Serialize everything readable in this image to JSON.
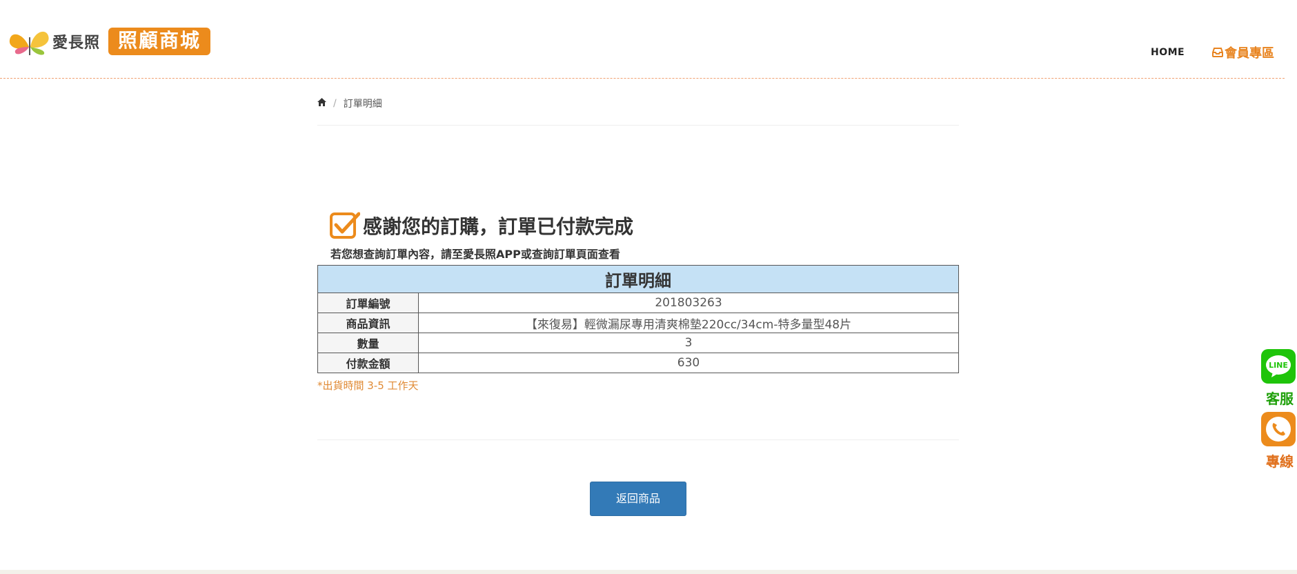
{
  "header": {
    "brand_text": "愛長照",
    "brand_pill": "照顧商城",
    "nav": {
      "home": "HOME",
      "member": "會員專區"
    }
  },
  "breadcrumb": {
    "home_icon": "home-icon",
    "current": "訂單明細"
  },
  "success": {
    "icon": "checkbox-checked-icon",
    "title": "感謝您的訂購，訂單已付款完成",
    "subtitle": "若您想查詢訂單內容，請至愛長照APP或查詢訂單頁面查看"
  },
  "order": {
    "heading": "訂單明細",
    "rows": [
      {
        "label": "訂單編號",
        "value": "201803263"
      },
      {
        "label": "商品資訊",
        "value": "【來復易】輕微漏尿專用清爽棉墊220cc/34cm-特多量型48片"
      },
      {
        "label": "數量",
        "value": "3"
      },
      {
        "label": "付款金額",
        "value": "630"
      }
    ],
    "shipping_note": "*出貨時間 3-5 工作天"
  },
  "actions": {
    "back_label": "返回商品"
  },
  "side_widgets": {
    "line": {
      "badge": "LINE",
      "label": "客服"
    },
    "phone": {
      "label": "專線"
    }
  },
  "colors": {
    "brand_orange": "#ec8b1c",
    "table_header": "#c5e1f5",
    "primary_button": "#337ab7",
    "line_green": "#1fc40a",
    "note_orange": "#e08a34"
  }
}
